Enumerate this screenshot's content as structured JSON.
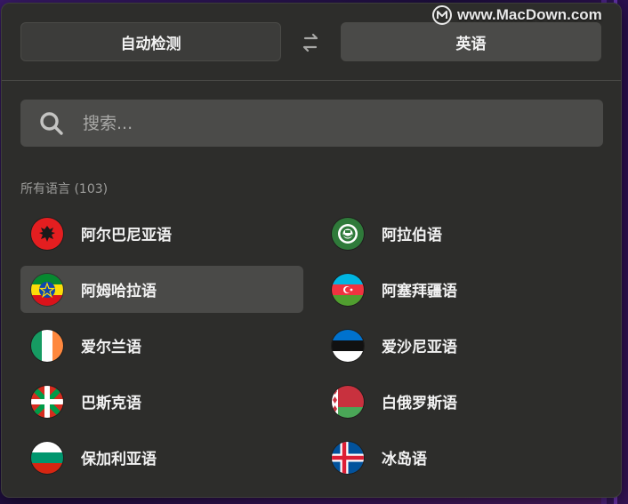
{
  "header": {
    "source_language": "自动检测",
    "target_language": "英语",
    "swap_icon": "swap-arrows-icon"
  },
  "search": {
    "placeholder": "搜索...",
    "value": "",
    "icon": "search-icon"
  },
  "list": {
    "section_label": "所有语言 (103)",
    "selected_index": 2,
    "languages": [
      {
        "label": "阿尔巴尼亚语",
        "flag": "albania-flag-icon"
      },
      {
        "label": "阿拉伯语",
        "flag": "arabic-flag-icon"
      },
      {
        "label": "阿姆哈拉语",
        "flag": "ethiopia-flag-icon"
      },
      {
        "label": "阿塞拜疆语",
        "flag": "azerbaijan-flag-icon"
      },
      {
        "label": "爱尔兰语",
        "flag": "ireland-flag-icon"
      },
      {
        "label": "爱沙尼亚语",
        "flag": "estonia-flag-icon"
      },
      {
        "label": "巴斯克语",
        "flag": "basque-flag-icon"
      },
      {
        "label": "白俄罗斯语",
        "flag": "belarus-flag-icon"
      },
      {
        "label": "保加利亚语",
        "flag": "bulgaria-flag-icon"
      },
      {
        "label": "冰岛语",
        "flag": "iceland-flag-icon"
      }
    ]
  },
  "watermark": {
    "text": "www.MacDown.com",
    "logo": "macdown-logo-icon"
  }
}
